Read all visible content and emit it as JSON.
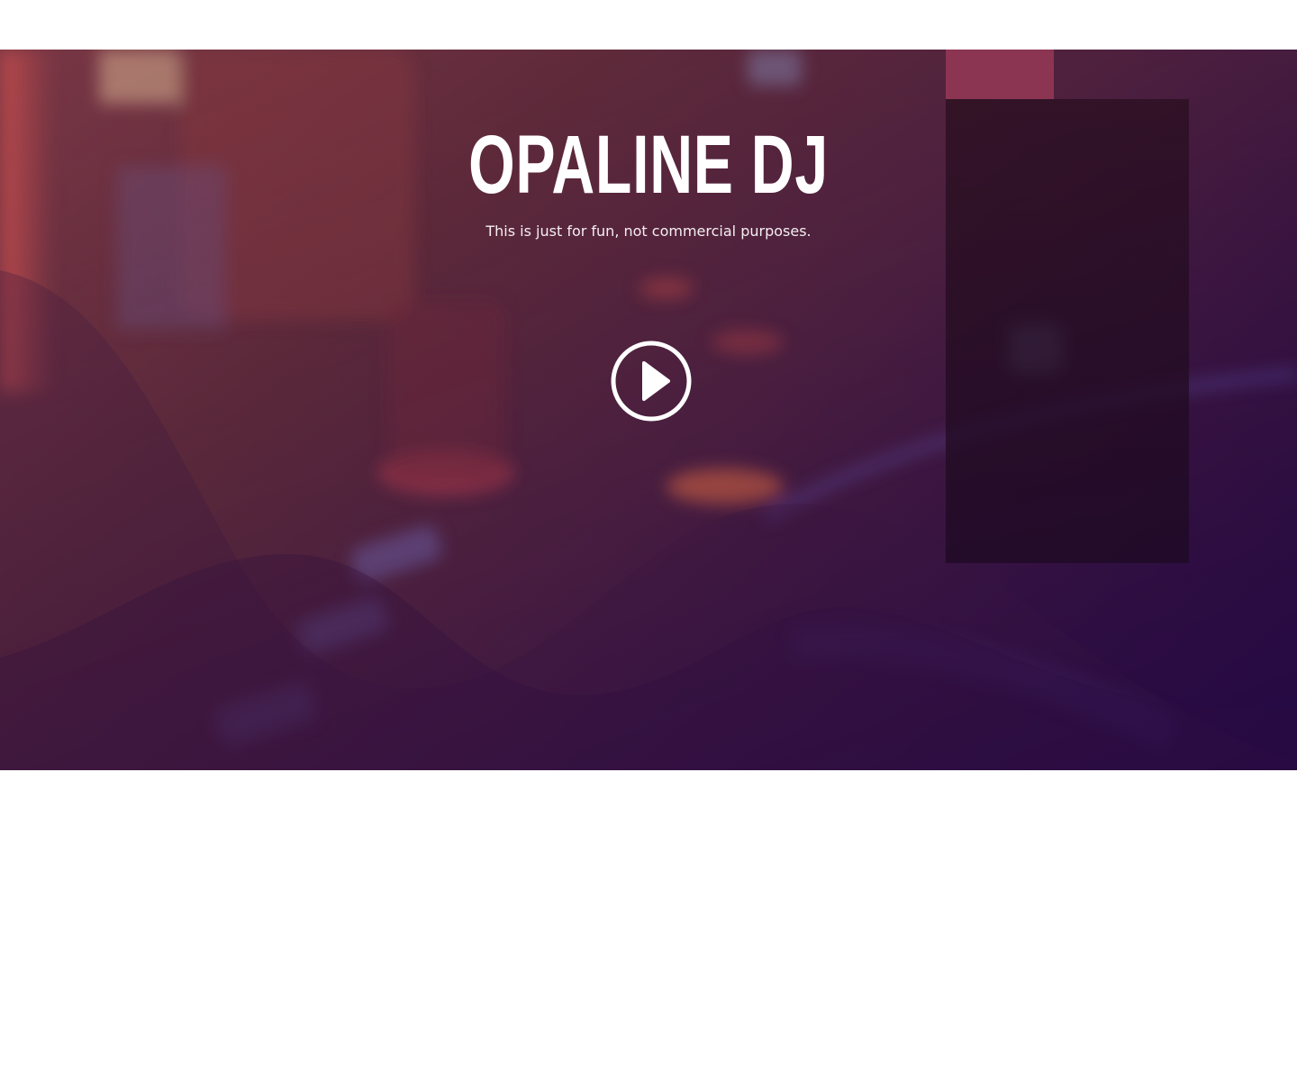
{
  "hero": {
    "title": "OPALINE DJ",
    "subtitle": "This is just for fun, not commercial purposes.",
    "play_icon": "play-circle-icon"
  },
  "colors": {
    "accent": "#a03c5a",
    "panel": "#281020",
    "gradient_start": "#7a3a4a",
    "gradient_end": "#200840",
    "text": "#ffffff"
  }
}
